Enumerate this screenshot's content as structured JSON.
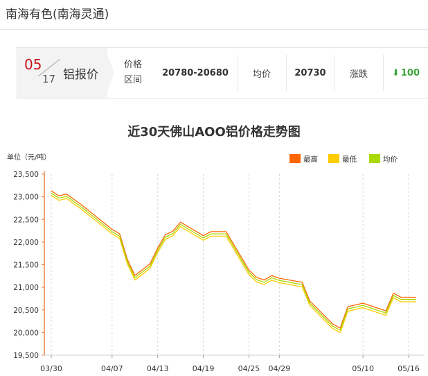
{
  "header": {
    "title": "南海有色(南海灵通)"
  },
  "price_bar": {
    "month": "05",
    "day": "17",
    "product": "铝报价",
    "range_label_line1": "价格",
    "range_label_line2": "区间",
    "range_value": "20780-20680",
    "avg_label": "均价",
    "avg_value": "20730",
    "change_label": "涨跌",
    "change_value": "100",
    "change_direction": "down",
    "change_color": "#3aa53a"
  },
  "chart_data": {
    "type": "line",
    "title": "近30天佛山AOO铝价格走势图",
    "ylabel": "单位（元/吨）",
    "ylim": [
      19500,
      23500
    ],
    "yticks": [
      19500,
      20000,
      20500,
      21000,
      21500,
      22000,
      22500,
      23000,
      23500
    ],
    "ytick_labels": [
      "19,500",
      "20,000",
      "20,500",
      "21,000",
      "21,500",
      "22,000",
      "22,500",
      "23,000",
      "23,500"
    ],
    "x": [
      "03/30",
      "03/31",
      "04/01",
      "04/02",
      "04/03",
      "04/04",
      "04/05",
      "04/06",
      "04/07",
      "04/08",
      "04/09",
      "04/10",
      "04/11",
      "04/12",
      "04/13",
      "04/14",
      "04/15",
      "04/16",
      "04/17",
      "04/18",
      "04/19",
      "04/20",
      "04/21",
      "04/22",
      "04/23",
      "04/24",
      "04/25",
      "04/26",
      "04/27",
      "04/28",
      "04/29",
      "04/30",
      "05/01",
      "05/02",
      "05/03",
      "05/04",
      "05/05",
      "05/06",
      "05/07",
      "05/08",
      "05/09",
      "05/10",
      "05/11",
      "05/12",
      "05/13",
      "05/14",
      "05/15",
      "05/16",
      "05/17"
    ],
    "x_tick_labels": [
      "03/30",
      "04/07",
      "04/13",
      "04/19",
      "04/25",
      "04/29",
      "05/10",
      "05/16"
    ],
    "point_dates": [
      "03/30",
      "03/31",
      "04/01",
      "04/03",
      "04/07",
      "04/08",
      "04/09",
      "04/10",
      "04/12",
      "04/13",
      "04/14",
      "04/15",
      "04/16",
      "04/19",
      "04/20",
      "04/21",
      "04/22",
      "04/25",
      "04/26",
      "04/27",
      "04/28",
      "04/29",
      "05/02",
      "05/03",
      "05/06",
      "05/07",
      "05/08",
      "05/10",
      "05/13",
      "05/14",
      "05/15",
      "05/16",
      "05/17"
    ],
    "series": [
      {
        "name": "最高",
        "color": "#ff6600",
        "values": [
          23130,
          23020,
          23060,
          22820,
          22280,
          22180,
          21620,
          21260,
          21520,
          21870,
          22160,
          22240,
          22440,
          22140,
          22230,
          22230,
          22230,
          21380,
          21220,
          21160,
          21260,
          21200,
          21110,
          20700,
          20190,
          20100,
          20570,
          20650,
          20480,
          20870,
          20780,
          20780,
          20780
        ]
      },
      {
        "name": "最低",
        "color": "#ffcc00",
        "values": [
          23030,
          22920,
          22960,
          22720,
          22180,
          22080,
          21520,
          21160,
          21420,
          21770,
          22060,
          22140,
          22340,
          22040,
          22130,
          22130,
          22130,
          21280,
          21120,
          21060,
          21160,
          21100,
          21010,
          20600,
          20090,
          20000,
          20470,
          20550,
          20380,
          20770,
          20680,
          20680,
          20680
        ]
      },
      {
        "name": "均价",
        "color": "#a9d900",
        "values": [
          23080,
          22970,
          23010,
          22770,
          22230,
          22130,
          21570,
          21210,
          21470,
          21820,
          22110,
          22190,
          22390,
          22090,
          22180,
          22180,
          22180,
          21330,
          21170,
          21110,
          21210,
          21150,
          21060,
          20650,
          20140,
          20050,
          20520,
          20600,
          20430,
          20820,
          20730,
          20730,
          20730
        ]
      }
    ],
    "legend_position": "top-right",
    "grid": "vertical-dashed"
  }
}
